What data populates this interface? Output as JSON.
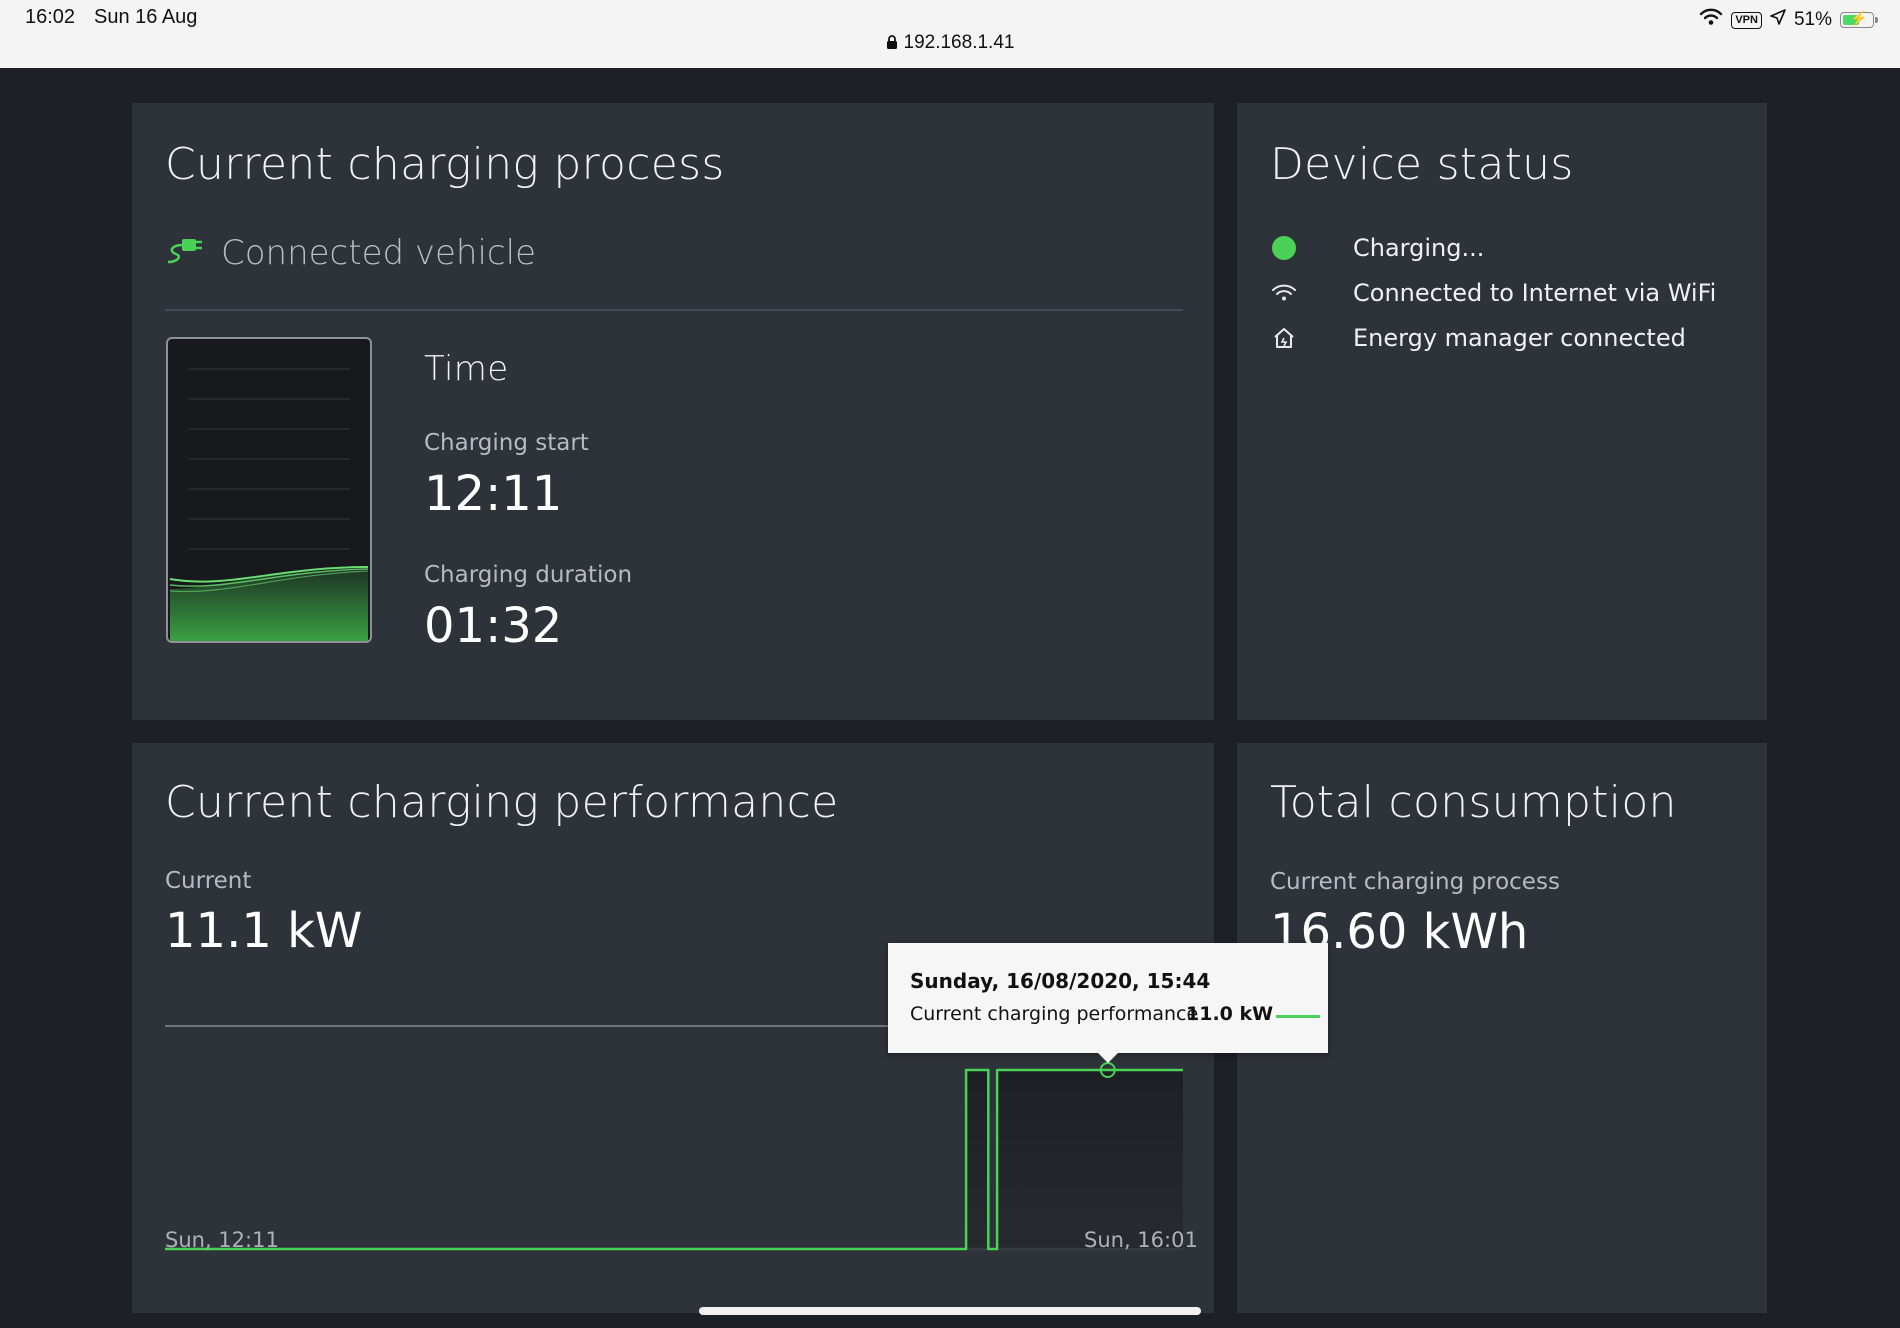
{
  "status_bar": {
    "time": "16:02",
    "date": "Sun 16 Aug",
    "url": "192.168.1.41",
    "vpn": "VPN",
    "battery": "51%"
  },
  "charging": {
    "title": "Current charging process",
    "vehicle": "Connected vehicle",
    "time_heading": "Time",
    "start_label": "Charging start",
    "start_value": "12:11",
    "duration_label": "Charging duration",
    "duration_value": "01:32"
  },
  "device": {
    "title": "Device status",
    "items": [
      {
        "icon": "green-dot-icon",
        "text": "Charging..."
      },
      {
        "icon": "wifi-icon",
        "text": "Connected to Internet via WiFi"
      },
      {
        "icon": "home-icon",
        "text": "Energy manager connected"
      }
    ]
  },
  "performance": {
    "title": "Current charging performance",
    "current_label": "Current",
    "current_value": "11.1 kW",
    "x_start_label": "Sun, 12:11",
    "x_end_label": "Sun, 16:01",
    "tooltip": {
      "date": "Sunday, 16/08/2020, 15:44",
      "series": "Current charging performance",
      "value": "11.0 kW"
    }
  },
  "total": {
    "title": "Total consumption",
    "label": "Current charging process",
    "value": "16.60 kWh"
  },
  "colors": {
    "accent_green": "#4ad158",
    "card_bg": "#2e3239",
    "page_bg": "#1d2127"
  },
  "chart_data": {
    "type": "line",
    "x": [
      "12:11",
      "14:17",
      "15:12",
      "15:14",
      "15:17",
      "15:19",
      "16:01"
    ],
    "series": [
      {
        "values": [
          0,
          0,
          11.0,
          11.0,
          0,
          11.0,
          11.0
        ]
      }
    ],
    "xlabel": "",
    "ylabel": "",
    "highlight": {
      "x": "15:44",
      "y": 11.0
    }
  }
}
